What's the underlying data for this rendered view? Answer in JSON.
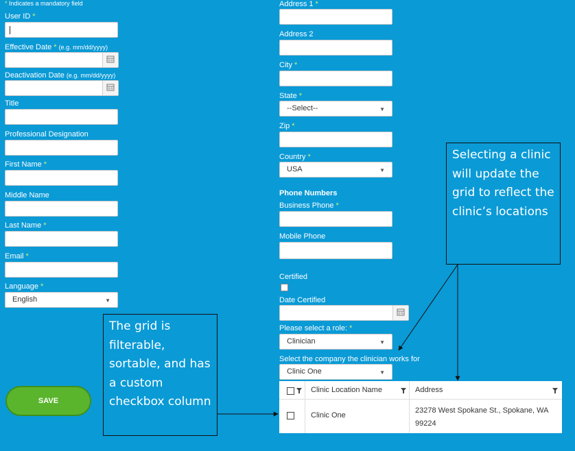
{
  "left": {
    "mandatory_note": "Indicates a mandatory field",
    "user_id_label": "User ID",
    "effective_date_label": "Effective Date",
    "effective_date_hint": "(e.g. mm/dd/yyyy)",
    "deactivation_date_label": "Deactivation Date",
    "deactivation_date_hint": "(e.g. mm/dd/yyyy)",
    "title_label": "Title",
    "professional_designation_label": "Professional Designation",
    "first_name_label": "First Name",
    "middle_name_label": "Middle Name",
    "last_name_label": "Last Name",
    "email_label": "Email",
    "language_label": "Language",
    "language_value": "English",
    "save_label": "SAVE"
  },
  "right": {
    "address1_label": "Address 1",
    "address2_label": "Address 2",
    "city_label": "City",
    "state_label": "State",
    "state_value": "--Select--",
    "zip_label": "Zip",
    "country_label": "Country",
    "country_value": "USA",
    "phone_numbers_heading": "Phone Numbers",
    "business_phone_label": "Business Phone",
    "mobile_phone_label": "Mobile Phone",
    "certified_label": "Certified",
    "date_certified_label": "Date Certified",
    "role_label": "Please select a role:",
    "role_value": "Clinician",
    "company_label": "Select the company the clinician works for",
    "company_value": "Clinic One"
  },
  "required_marker": "*",
  "grid": {
    "columns": [
      "Clinic Location Name",
      "Address"
    ],
    "rows": [
      {
        "name": "Clinic One",
        "address": "23278 West Spokane St., Spokane, WA 99224"
      }
    ]
  },
  "annotations": {
    "grid_note": "The grid is filterable, sortable, and has a custom checkbox column",
    "clinic_note": "Selecting a clinic will update the grid to reflect the clinic’s locations"
  },
  "colors": {
    "background": "#0a9ad6",
    "save_button": "#5ab52c",
    "required": "#c9f27a"
  }
}
